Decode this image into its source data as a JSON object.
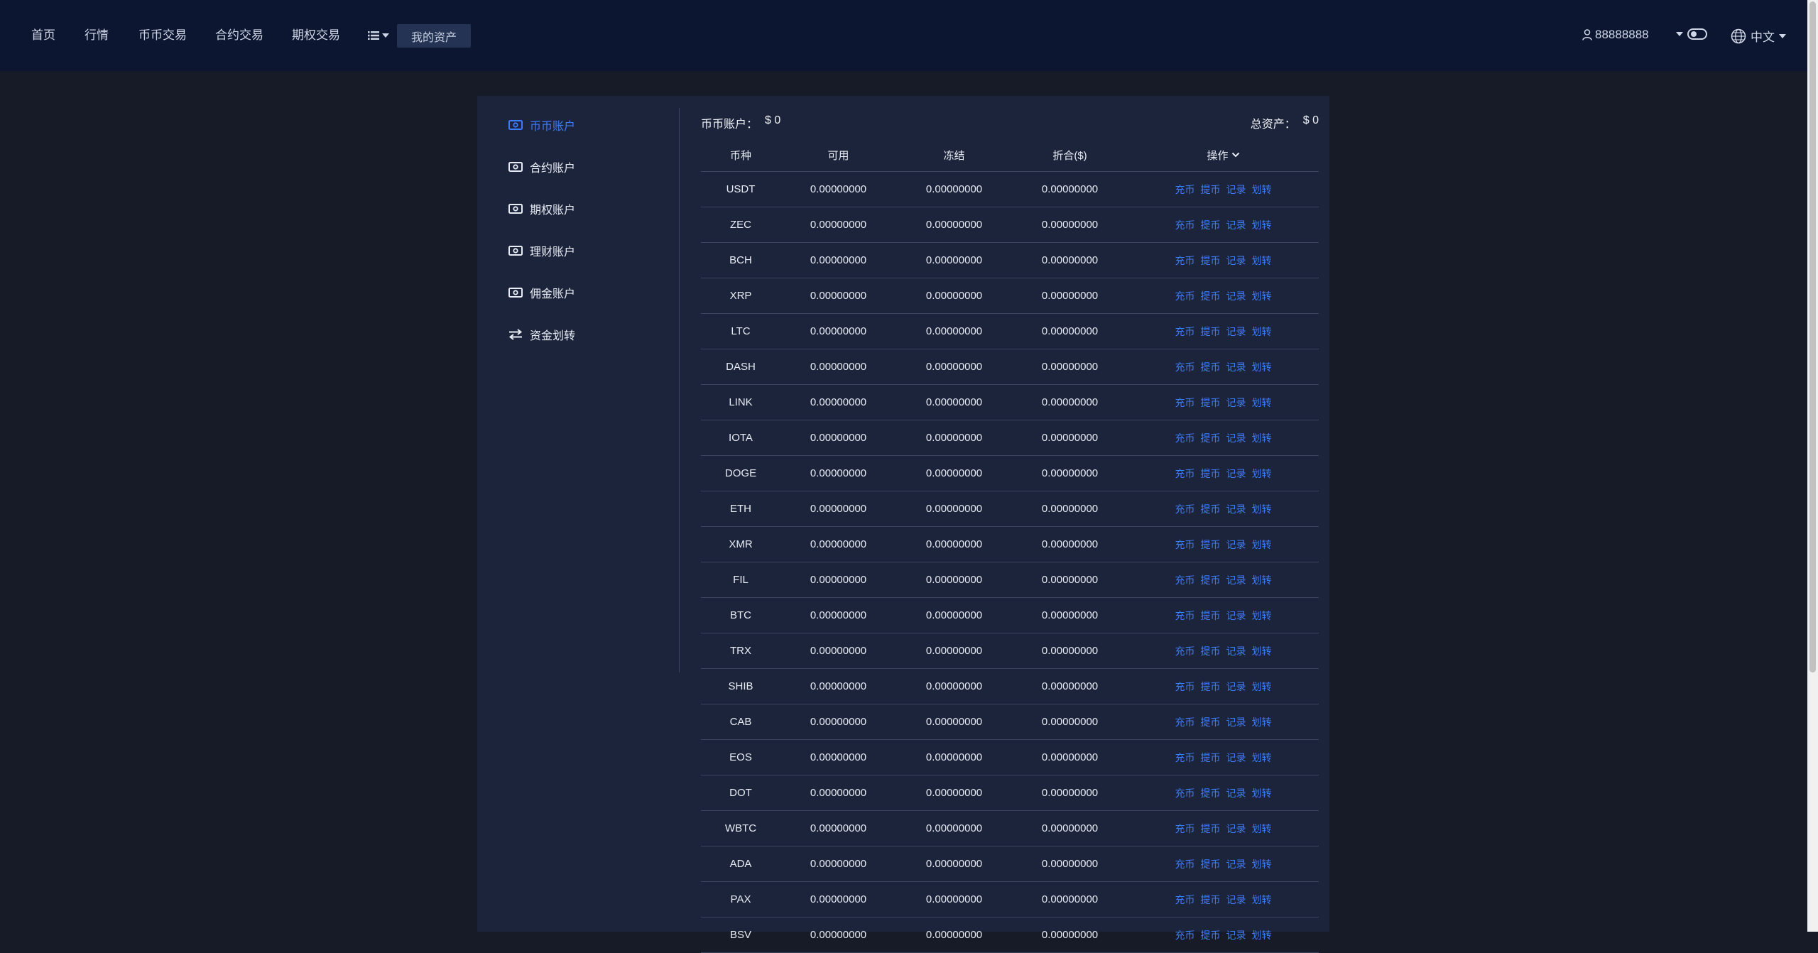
{
  "nav": {
    "home": "首页",
    "market": "行情",
    "spot": "币币交易",
    "contract": "合约交易",
    "options": "期权交易",
    "my_assets": "我的资产"
  },
  "user": {
    "name": "88888888"
  },
  "language": "中文",
  "sidebar": {
    "items": [
      {
        "label": "币币账户",
        "icon": "cash-icon",
        "active": true
      },
      {
        "label": "合约账户",
        "icon": "cash-icon",
        "active": false
      },
      {
        "label": "期权账户",
        "icon": "cash-icon",
        "active": false
      },
      {
        "label": "理财账户",
        "icon": "cash-icon",
        "active": false
      },
      {
        "label": "佣金账户",
        "icon": "cash-icon",
        "active": false
      },
      {
        "label": "资金划转",
        "icon": "transfer-icon",
        "active": false
      }
    ]
  },
  "summary": {
    "account_label": "币币账户：",
    "account_value": "$ 0",
    "total_label": "总资产：",
    "total_value": "$ 0"
  },
  "table": {
    "columns": [
      "币种",
      "可用",
      "冻结",
      "折合($)",
      "操作"
    ],
    "actions": [
      "充币",
      "提币",
      "记录",
      "划转"
    ],
    "rows": [
      [
        "USDT",
        "0.00000000",
        "0.00000000",
        "0.00000000"
      ],
      [
        "ZEC",
        "0.00000000",
        "0.00000000",
        "0.00000000"
      ],
      [
        "BCH",
        "0.00000000",
        "0.00000000",
        "0.00000000"
      ],
      [
        "XRP",
        "0.00000000",
        "0.00000000",
        "0.00000000"
      ],
      [
        "LTC",
        "0.00000000",
        "0.00000000",
        "0.00000000"
      ],
      [
        "DASH",
        "0.00000000",
        "0.00000000",
        "0.00000000"
      ],
      [
        "LINK",
        "0.00000000",
        "0.00000000",
        "0.00000000"
      ],
      [
        "IOTA",
        "0.00000000",
        "0.00000000",
        "0.00000000"
      ],
      [
        "DOGE",
        "0.00000000",
        "0.00000000",
        "0.00000000"
      ],
      [
        "ETH",
        "0.00000000",
        "0.00000000",
        "0.00000000"
      ],
      [
        "XMR",
        "0.00000000",
        "0.00000000",
        "0.00000000"
      ],
      [
        "FIL",
        "0.00000000",
        "0.00000000",
        "0.00000000"
      ],
      [
        "BTC",
        "0.00000000",
        "0.00000000",
        "0.00000000"
      ],
      [
        "TRX",
        "0.00000000",
        "0.00000000",
        "0.00000000"
      ],
      [
        "SHIB",
        "0.00000000",
        "0.00000000",
        "0.00000000"
      ],
      [
        "CAB",
        "0.00000000",
        "0.00000000",
        "0.00000000"
      ],
      [
        "EOS",
        "0.00000000",
        "0.00000000",
        "0.00000000"
      ],
      [
        "DOT",
        "0.00000000",
        "0.00000000",
        "0.00000000"
      ],
      [
        "WBTC",
        "0.00000000",
        "0.00000000",
        "0.00000000"
      ],
      [
        "ADA",
        "0.00000000",
        "0.00000000",
        "0.00000000"
      ],
      [
        "PAX",
        "0.00000000",
        "0.00000000",
        "0.00000000"
      ],
      [
        "BSV",
        "0.00000000",
        "0.00000000",
        "0.00000000"
      ]
    ]
  },
  "colors": {
    "background": "#161b27",
    "header": "#0c1631",
    "panel": "#1b243a",
    "accent": "#3c7cff"
  }
}
